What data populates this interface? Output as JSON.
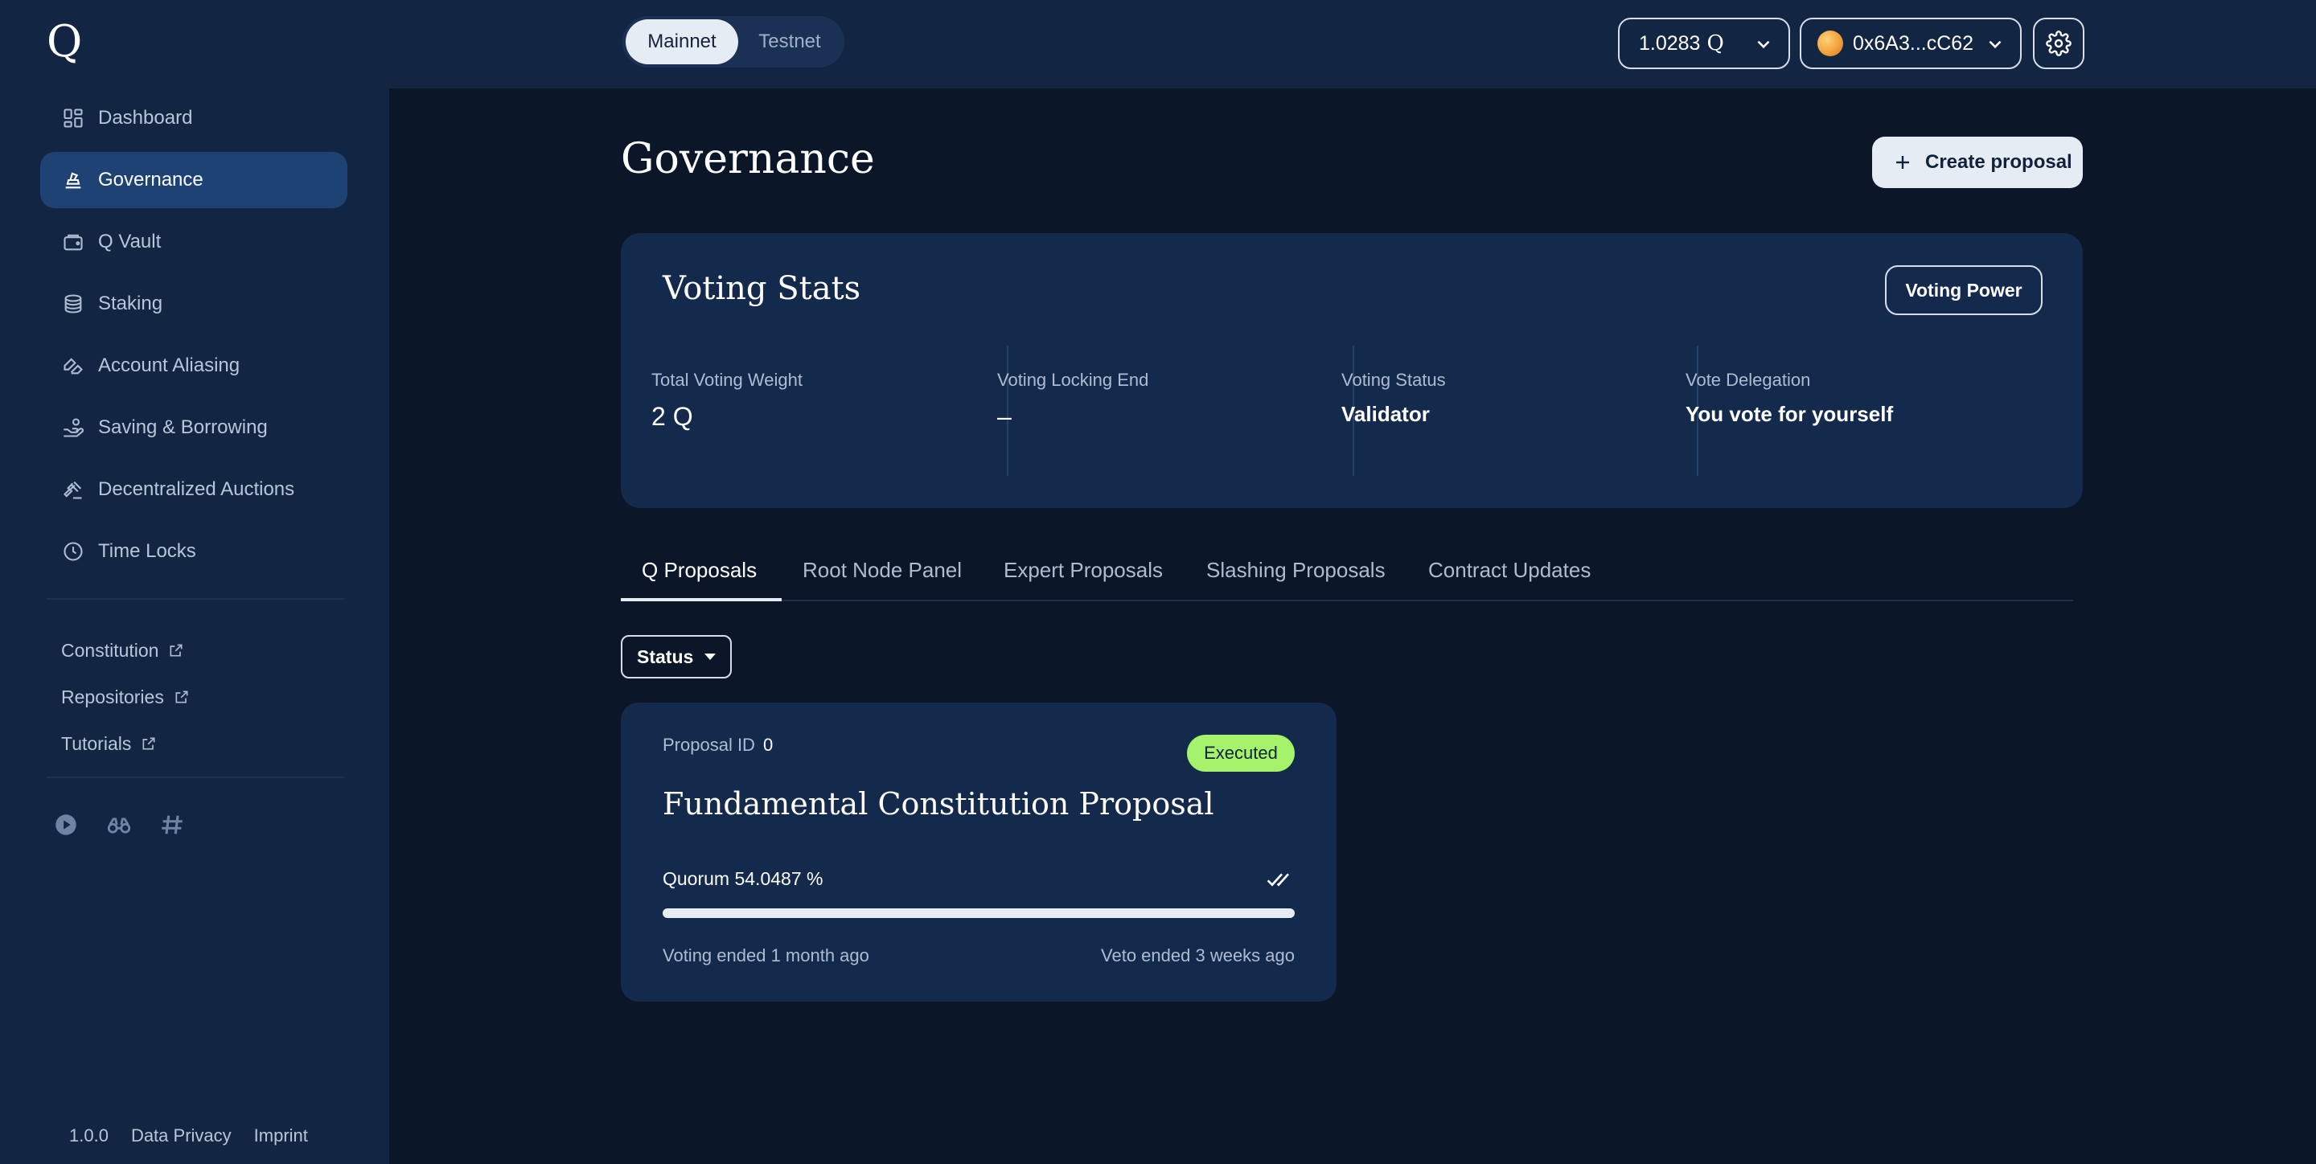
{
  "app": {
    "logo": "Q"
  },
  "sidebar": {
    "items": [
      {
        "label": "Dashboard",
        "icon": "dashboard-icon"
      },
      {
        "label": "Governance",
        "icon": "governance-icon",
        "active": true
      },
      {
        "label": "Q Vault",
        "icon": "wallet-icon"
      },
      {
        "label": "Staking",
        "icon": "coins-icon"
      },
      {
        "label": "Account Aliasing",
        "icon": "alias-icon"
      },
      {
        "label": "Saving & Borrowing",
        "icon": "saving-icon"
      },
      {
        "label": "Decentralized Auctions",
        "icon": "gavel-icon"
      },
      {
        "label": "Time Locks",
        "icon": "clock-icon"
      }
    ],
    "external_links": [
      {
        "label": "Constitution"
      },
      {
        "label": "Repositories"
      },
      {
        "label": "Tutorials"
      }
    ],
    "social_icons": [
      "play-icon",
      "binoculars-icon",
      "hashtag-icon"
    ],
    "footer": {
      "version": "1.0.0",
      "privacy": "Data Privacy",
      "imprint": "Imprint"
    }
  },
  "topbar": {
    "networks": {
      "active": "Mainnet",
      "inactive": "Testnet"
    },
    "balance": "1.0283",
    "balance_unit": "Q",
    "wallet_address": "0x6A3...cC62",
    "settings_icon": "gear-icon"
  },
  "main": {
    "title": "Governance",
    "create_button": "Create proposal",
    "stats": {
      "title": "Voting Stats",
      "voting_power_button": "Voting Power",
      "items": [
        {
          "label": "Total Voting Weight",
          "value": "2 Q"
        },
        {
          "label": "Voting Locking End",
          "value": "–"
        },
        {
          "label": "Voting Status",
          "value": "Validator"
        },
        {
          "label": "Vote Delegation",
          "value": "You vote for yourself"
        }
      ]
    },
    "tabs": [
      {
        "label": "Q Proposals",
        "active": true
      },
      {
        "label": "Root Node Panel"
      },
      {
        "label": "Expert Proposals"
      },
      {
        "label": "Slashing Proposals"
      },
      {
        "label": "Contract Updates"
      }
    ],
    "filter": {
      "label": "Status"
    },
    "proposal": {
      "id_label": "Proposal ID",
      "id": "0",
      "status": "Executed",
      "title": "Fundamental Constitution Proposal",
      "quorum": "Quorum 54.0487 %",
      "progress": 1.0,
      "voting_ended": "Voting ended 1 month ago",
      "veto_ended": "Veto ended 3 weeks ago"
    }
  },
  "colors": {
    "background": "#0b1628",
    "sidebar": "#122542",
    "card": "#142a4c",
    "active_nav": "#1f4274",
    "executed_badge": "#a5f26b"
  }
}
